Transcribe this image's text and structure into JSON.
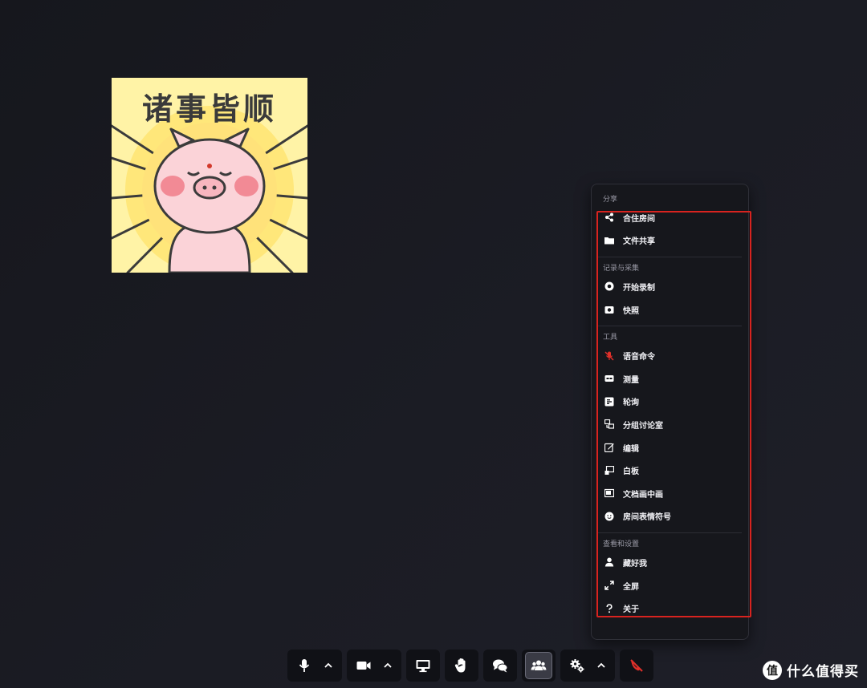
{
  "sticker": {
    "caption": "诸事皆顺"
  },
  "menu": {
    "groups": [
      {
        "title": "分享",
        "items": [
          {
            "label": "合住房间",
            "icon": "share-icon"
          },
          {
            "label": "文件共享",
            "icon": "folder-icon"
          }
        ]
      },
      {
        "title": "记录与采集",
        "items": [
          {
            "label": "开始录制",
            "icon": "record-icon"
          },
          {
            "label": "快照",
            "icon": "camera-icon"
          }
        ]
      },
      {
        "title": "工具",
        "items": [
          {
            "label": "语音命令",
            "icon": "mic-off-icon"
          },
          {
            "label": "测量",
            "icon": "cc-icon"
          },
          {
            "label": "轮询",
            "icon": "poll-icon"
          },
          {
            "label": "分组讨论室",
            "icon": "breakout-icon"
          },
          {
            "label": "编辑",
            "icon": "edit-icon"
          },
          {
            "label": "白板",
            "icon": "whiteboard-icon"
          },
          {
            "label": "文档画中画",
            "icon": "pip-icon"
          },
          {
            "label": "房间表情符号",
            "icon": "emoji-icon"
          }
        ]
      },
      {
        "title": "查看和设置",
        "items": [
          {
            "label": "藏好我",
            "icon": "user-icon"
          },
          {
            "label": "全屏",
            "icon": "expand-icon"
          },
          {
            "label": "关于",
            "icon": "question-icon"
          }
        ]
      }
    ]
  },
  "watermark": {
    "logo": "值",
    "text": "什么值得买"
  },
  "colors": {
    "highlight": "#d8231f",
    "hangup": "#e0302a",
    "mic_off": "#e0302a"
  }
}
